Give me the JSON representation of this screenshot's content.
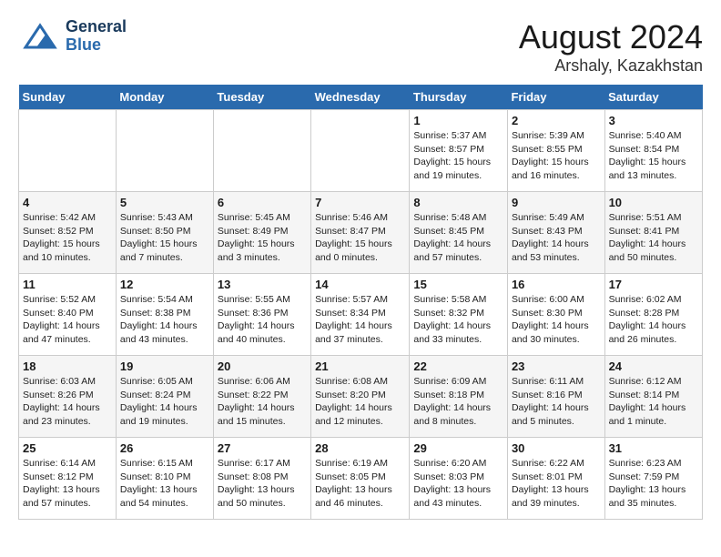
{
  "header": {
    "logo_general": "General",
    "logo_blue": "Blue",
    "title": "August 2024",
    "subtitle": "Arshaly, Kazakhstan"
  },
  "days_of_week": [
    "Sunday",
    "Monday",
    "Tuesday",
    "Wednesday",
    "Thursday",
    "Friday",
    "Saturday"
  ],
  "weeks": [
    [
      {
        "day": "",
        "info": ""
      },
      {
        "day": "",
        "info": ""
      },
      {
        "day": "",
        "info": ""
      },
      {
        "day": "",
        "info": ""
      },
      {
        "day": "1",
        "info": "Sunrise: 5:37 AM\nSunset: 8:57 PM\nDaylight: 15 hours\nand 19 minutes."
      },
      {
        "day": "2",
        "info": "Sunrise: 5:39 AM\nSunset: 8:55 PM\nDaylight: 15 hours\nand 16 minutes."
      },
      {
        "day": "3",
        "info": "Sunrise: 5:40 AM\nSunset: 8:54 PM\nDaylight: 15 hours\nand 13 minutes."
      }
    ],
    [
      {
        "day": "4",
        "info": "Sunrise: 5:42 AM\nSunset: 8:52 PM\nDaylight: 15 hours\nand 10 minutes."
      },
      {
        "day": "5",
        "info": "Sunrise: 5:43 AM\nSunset: 8:50 PM\nDaylight: 15 hours\nand 7 minutes."
      },
      {
        "day": "6",
        "info": "Sunrise: 5:45 AM\nSunset: 8:49 PM\nDaylight: 15 hours\nand 3 minutes."
      },
      {
        "day": "7",
        "info": "Sunrise: 5:46 AM\nSunset: 8:47 PM\nDaylight: 15 hours\nand 0 minutes."
      },
      {
        "day": "8",
        "info": "Sunrise: 5:48 AM\nSunset: 8:45 PM\nDaylight: 14 hours\nand 57 minutes."
      },
      {
        "day": "9",
        "info": "Sunrise: 5:49 AM\nSunset: 8:43 PM\nDaylight: 14 hours\nand 53 minutes."
      },
      {
        "day": "10",
        "info": "Sunrise: 5:51 AM\nSunset: 8:41 PM\nDaylight: 14 hours\nand 50 minutes."
      }
    ],
    [
      {
        "day": "11",
        "info": "Sunrise: 5:52 AM\nSunset: 8:40 PM\nDaylight: 14 hours\nand 47 minutes."
      },
      {
        "day": "12",
        "info": "Sunrise: 5:54 AM\nSunset: 8:38 PM\nDaylight: 14 hours\nand 43 minutes."
      },
      {
        "day": "13",
        "info": "Sunrise: 5:55 AM\nSunset: 8:36 PM\nDaylight: 14 hours\nand 40 minutes."
      },
      {
        "day": "14",
        "info": "Sunrise: 5:57 AM\nSunset: 8:34 PM\nDaylight: 14 hours\nand 37 minutes."
      },
      {
        "day": "15",
        "info": "Sunrise: 5:58 AM\nSunset: 8:32 PM\nDaylight: 14 hours\nand 33 minutes."
      },
      {
        "day": "16",
        "info": "Sunrise: 6:00 AM\nSunset: 8:30 PM\nDaylight: 14 hours\nand 30 minutes."
      },
      {
        "day": "17",
        "info": "Sunrise: 6:02 AM\nSunset: 8:28 PM\nDaylight: 14 hours\nand 26 minutes."
      }
    ],
    [
      {
        "day": "18",
        "info": "Sunrise: 6:03 AM\nSunset: 8:26 PM\nDaylight: 14 hours\nand 23 minutes."
      },
      {
        "day": "19",
        "info": "Sunrise: 6:05 AM\nSunset: 8:24 PM\nDaylight: 14 hours\nand 19 minutes."
      },
      {
        "day": "20",
        "info": "Sunrise: 6:06 AM\nSunset: 8:22 PM\nDaylight: 14 hours\nand 15 minutes."
      },
      {
        "day": "21",
        "info": "Sunrise: 6:08 AM\nSunset: 8:20 PM\nDaylight: 14 hours\nand 12 minutes."
      },
      {
        "day": "22",
        "info": "Sunrise: 6:09 AM\nSunset: 8:18 PM\nDaylight: 14 hours\nand 8 minutes."
      },
      {
        "day": "23",
        "info": "Sunrise: 6:11 AM\nSunset: 8:16 PM\nDaylight: 14 hours\nand 5 minutes."
      },
      {
        "day": "24",
        "info": "Sunrise: 6:12 AM\nSunset: 8:14 PM\nDaylight: 14 hours\nand 1 minute."
      }
    ],
    [
      {
        "day": "25",
        "info": "Sunrise: 6:14 AM\nSunset: 8:12 PM\nDaylight: 13 hours\nand 57 minutes."
      },
      {
        "day": "26",
        "info": "Sunrise: 6:15 AM\nSunset: 8:10 PM\nDaylight: 13 hours\nand 54 minutes."
      },
      {
        "day": "27",
        "info": "Sunrise: 6:17 AM\nSunset: 8:08 PM\nDaylight: 13 hours\nand 50 minutes."
      },
      {
        "day": "28",
        "info": "Sunrise: 6:19 AM\nSunset: 8:05 PM\nDaylight: 13 hours\nand 46 minutes."
      },
      {
        "day": "29",
        "info": "Sunrise: 6:20 AM\nSunset: 8:03 PM\nDaylight: 13 hours\nand 43 minutes."
      },
      {
        "day": "30",
        "info": "Sunrise: 6:22 AM\nSunset: 8:01 PM\nDaylight: 13 hours\nand 39 minutes."
      },
      {
        "day": "31",
        "info": "Sunrise: 6:23 AM\nSunset: 7:59 PM\nDaylight: 13 hours\nand 35 minutes."
      }
    ]
  ]
}
